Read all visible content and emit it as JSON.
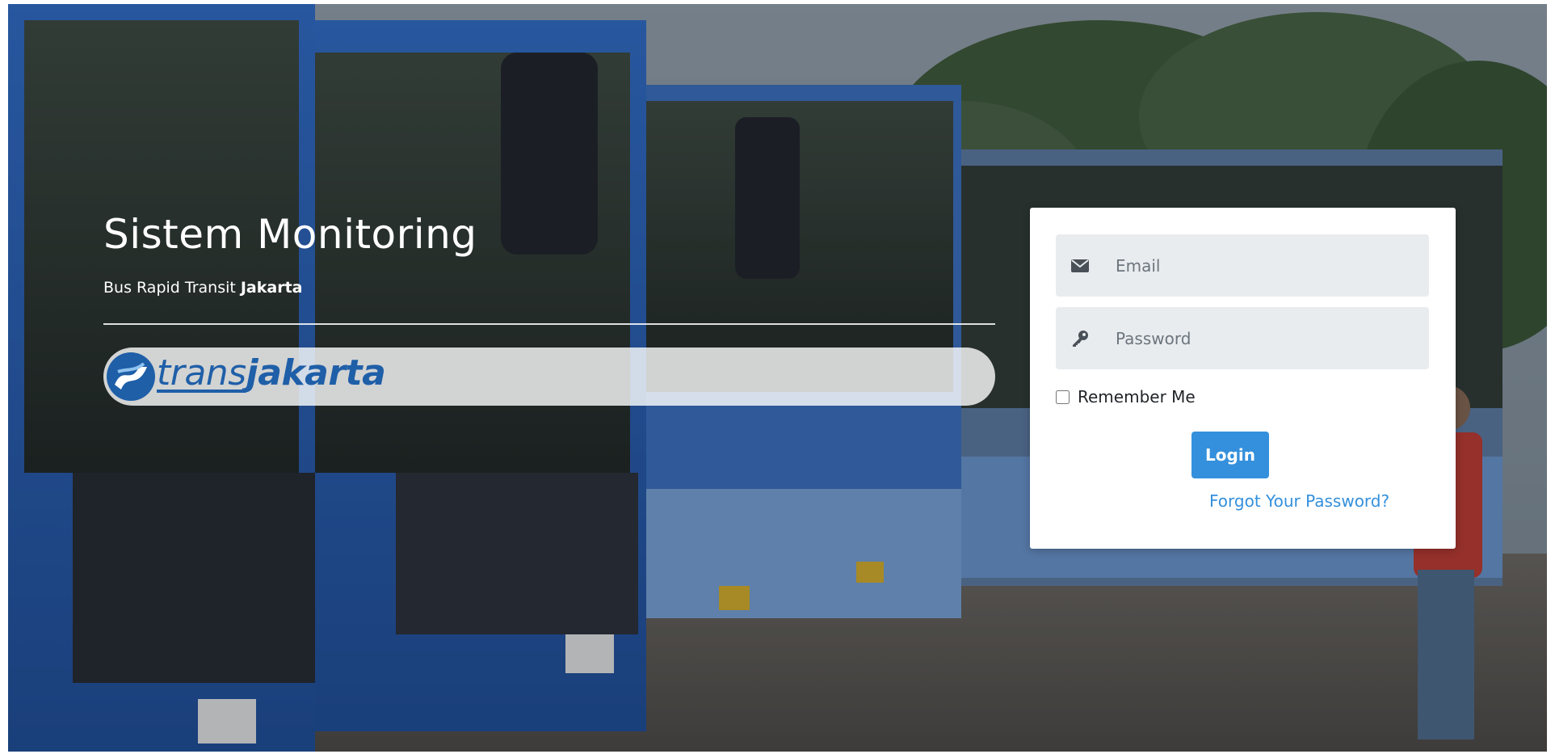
{
  "hero": {
    "title": "Sistem Monitoring",
    "subtitle_prefix": "Bus Rapid Transit ",
    "subtitle_bold": "Jakarta",
    "logo_prefix": "trans",
    "logo_suffix": "jakarta"
  },
  "login": {
    "email_placeholder": "Email",
    "password_placeholder": "Password",
    "remember_label": "Remember Me",
    "remember_checked": false,
    "login_label": "Login",
    "forgot_label": "Forgot Your Password?"
  },
  "icons": {
    "email": "envelope-icon",
    "password": "key-icon",
    "logo": "transjakarta-logo-icon"
  },
  "colors": {
    "primary": "#3490dc",
    "logo_blue": "#1f5fa8",
    "field_bg": "#e9ecef"
  }
}
